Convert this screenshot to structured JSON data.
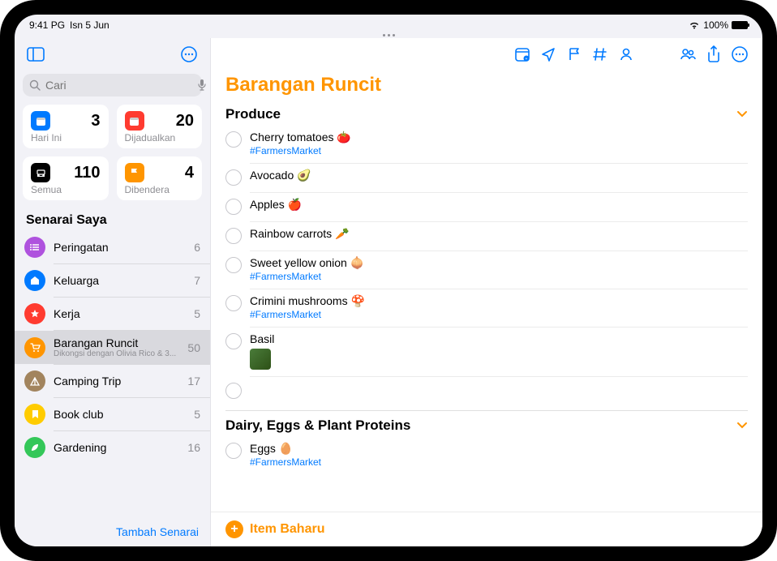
{
  "status": {
    "time": "9:41 PG",
    "date": "Isn 5 Jun",
    "battery": "100%"
  },
  "search": {
    "placeholder": "Cari"
  },
  "smart": [
    {
      "label": "Hari Ini",
      "count": "3",
      "bg": "#007aff",
      "glyph": "calendar"
    },
    {
      "label": "Dijadualkan",
      "count": "20",
      "bg": "#ff3b30",
      "glyph": "calendar"
    },
    {
      "label": "Semua",
      "count": "110",
      "bg": "#000",
      "glyph": "tray"
    },
    {
      "label": "Dibendera",
      "count": "4",
      "bg": "#ff9500",
      "glyph": "flag"
    }
  ],
  "lists_header": "Senarai Saya",
  "lists": [
    {
      "title": "Peringatan",
      "count": "6",
      "bg": "#af52de",
      "glyph": "list"
    },
    {
      "title": "Keluarga",
      "count": "7",
      "bg": "#007aff",
      "glyph": "house"
    },
    {
      "title": "Kerja",
      "count": "5",
      "bg": "#ff3b30",
      "glyph": "star"
    },
    {
      "title": "Barangan Runcit",
      "sub": "Dikongsi dengan Olivia Rico & 3...",
      "count": "50",
      "bg": "#ff9500",
      "glyph": "cart",
      "selected": true
    },
    {
      "title": "Camping Trip",
      "count": "17",
      "bg": "#a2845e",
      "glyph": "tent"
    },
    {
      "title": "Book club",
      "count": "5",
      "bg": "#ffcc00",
      "glyph": "bookmark"
    },
    {
      "title": "Gardening",
      "count": "16",
      "bg": "#34c759",
      "glyph": "leaf"
    }
  ],
  "add_list": "Tambah Senarai",
  "main_title": "Barangan Runcit",
  "groups": [
    {
      "title": "Produce",
      "items": [
        {
          "text": "Cherry tomatoes 🍅",
          "tag": "#FarmersMarket"
        },
        {
          "text": "Avocado 🥑"
        },
        {
          "text": "Apples 🍎"
        },
        {
          "text": "Rainbow carrots 🥕"
        },
        {
          "text": "Sweet yellow onion 🧅",
          "tag": "#FarmersMarket"
        },
        {
          "text": "Crimini mushrooms 🍄",
          "tag": "#FarmersMarket"
        },
        {
          "text": "Basil",
          "thumb": true
        }
      ],
      "empty_trailing": true
    },
    {
      "title": "Dairy, Eggs & Plant Proteins",
      "items": [
        {
          "text": "Eggs 🥚",
          "tag": "#FarmersMarket"
        }
      ]
    }
  ],
  "new_item": "Item Baharu"
}
